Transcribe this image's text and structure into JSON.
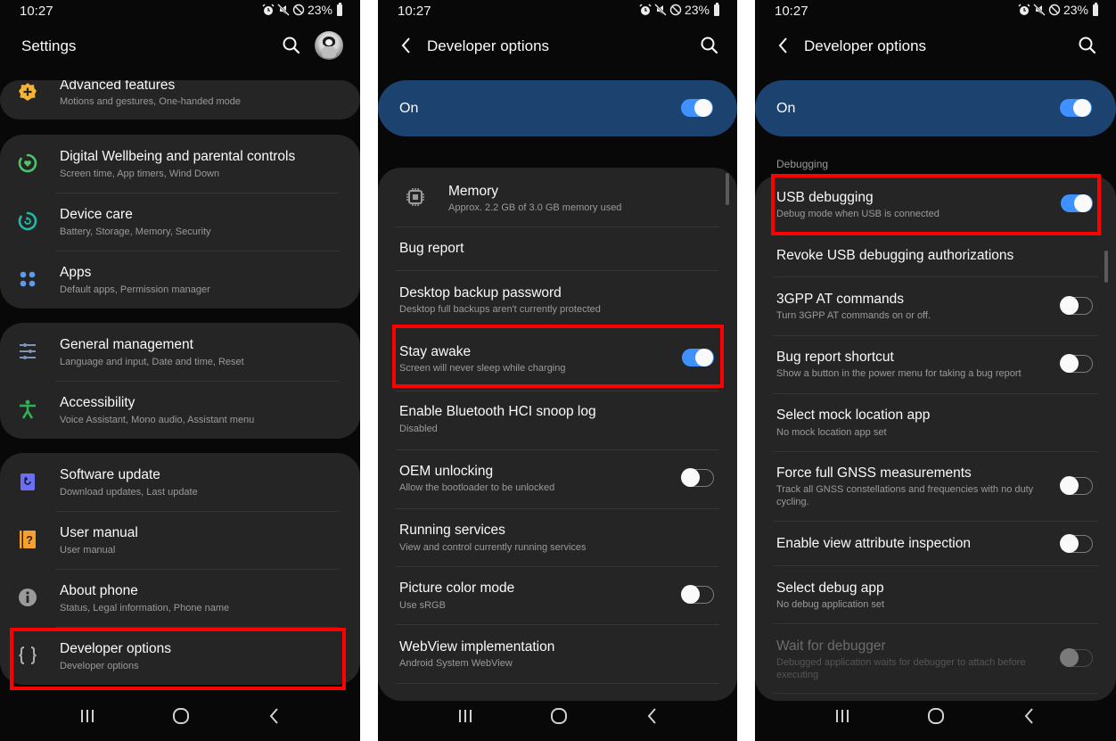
{
  "status_bar": {
    "time": "10:27",
    "battery": "23%",
    "icons": [
      "alarm-icon",
      "mute-icon",
      "do-not-disturb-icon",
      "battery-icon"
    ]
  },
  "screen1": {
    "title": "Settings",
    "cards": [
      {
        "items": [
          {
            "id": "advanced-features",
            "icon": "advanced-features-icon",
            "icon_color": "#f5b335",
            "title": "Advanced features",
            "subtitle": "Motions and gestures, One-handed mode"
          }
        ]
      },
      {
        "items": [
          {
            "id": "digital-wellbeing",
            "icon": "digital-wellbeing-icon",
            "icon_color": "#4cc56a",
            "title": "Digital Wellbeing and parental controls",
            "subtitle": "Screen time, App timers, Wind Down"
          },
          {
            "id": "device-care",
            "icon": "device-care-icon",
            "icon_color": "#1fb9a6",
            "title": "Device care",
            "subtitle": "Battery, Storage, Memory, Security"
          },
          {
            "id": "apps",
            "icon": "apps-icon",
            "icon_color": "#5a9cf0",
            "title": "Apps",
            "subtitle": "Default apps, Permission manager"
          }
        ]
      },
      {
        "items": [
          {
            "id": "general-management",
            "icon": "general-management-icon",
            "icon_color": "#7d96b8",
            "title": "General management",
            "subtitle": "Language and input, Date and time, Reset"
          },
          {
            "id": "accessibility",
            "icon": "accessibility-icon",
            "icon_color": "#2fb055",
            "title": "Accessibility",
            "subtitle": "Voice Assistant, Mono audio, Assistant menu"
          }
        ]
      },
      {
        "items": [
          {
            "id": "software-update",
            "icon": "software-update-icon",
            "icon_color": "#6b6ff5",
            "title": "Software update",
            "subtitle": "Download updates, Last update"
          },
          {
            "id": "user-manual",
            "icon": "user-manual-icon",
            "icon_color": "#f5a030",
            "title": "User manual",
            "subtitle": "User manual"
          },
          {
            "id": "about-phone",
            "icon": "info-icon",
            "icon_color": "#9a9a9a",
            "title": "About phone",
            "subtitle": "Status, Legal information, Phone name"
          },
          {
            "id": "developer-options",
            "icon": "developer-options-icon",
            "icon_color": "#b0b0b0",
            "title": "Developer options",
            "subtitle": "Developer options"
          }
        ]
      }
    ]
  },
  "screen2": {
    "title": "Developer options",
    "master_label": "On",
    "master_on": true,
    "items": [
      {
        "id": "memory",
        "title": "Memory",
        "subtitle": "Approx. 2.2 GB of 3.0 GB memory used",
        "icon": "memory-chip-icon"
      },
      {
        "id": "bug-report",
        "title": "Bug report"
      },
      {
        "id": "desktop-backup-password",
        "title": "Desktop backup password",
        "subtitle": "Desktop full backups aren't currently protected"
      },
      {
        "id": "stay-awake",
        "title": "Stay awake",
        "subtitle": "Screen will never sleep while charging",
        "toggle": true
      },
      {
        "id": "bluetooth-hci-snoop",
        "title": "Enable Bluetooth HCI snoop log",
        "subtitle": "Disabled"
      },
      {
        "id": "oem-unlocking",
        "title": "OEM unlocking",
        "subtitle": "Allow the bootloader to be unlocked",
        "toggle": false
      },
      {
        "id": "running-services",
        "title": "Running services",
        "subtitle": "View and control currently running services"
      },
      {
        "id": "picture-color-mode",
        "title": "Picture color mode",
        "subtitle": "Use sRGB",
        "toggle": false
      },
      {
        "id": "webview-implementation",
        "title": "WebView implementation",
        "subtitle": "Android System WebView"
      }
    ]
  },
  "screen3": {
    "title": "Developer options",
    "master_label": "On",
    "master_on": true,
    "section": "Debugging",
    "items": [
      {
        "id": "usb-debugging",
        "title": "USB debugging",
        "subtitle": "Debug mode when USB is connected",
        "toggle": true
      },
      {
        "id": "revoke-usb-auth",
        "title": "Revoke USB debugging authorizations"
      },
      {
        "id": "3gpp-at-commands",
        "title": "3GPP AT commands",
        "subtitle": "Turn 3GPP AT commands on or off.",
        "toggle": false
      },
      {
        "id": "bug-report-shortcut",
        "title": "Bug report shortcut",
        "subtitle": "Show a button in the power menu for taking a bug report",
        "toggle": false
      },
      {
        "id": "mock-location-app",
        "title": "Select mock location app",
        "subtitle": "No mock location app set"
      },
      {
        "id": "force-gnss",
        "title": "Force full GNSS measurements",
        "subtitle": "Track all GNSS constellations and frequencies with no duty",
        "subtitle2": "cycling.",
        "toggle": false
      },
      {
        "id": "view-attribute-inspection",
        "title": "Enable view attribute inspection",
        "toggle": false
      },
      {
        "id": "select-debug-app",
        "title": "Select debug app",
        "subtitle": "No debug application set"
      },
      {
        "id": "wait-for-debugger",
        "title": "Wait for debugger",
        "subtitle": "Debugged application waits for debugger to attach before",
        "subtitle2": "executing",
        "toggle": false,
        "disabled": true
      }
    ]
  },
  "highlight_color": "#ff0000",
  "accent_color": "#3e91ff"
}
